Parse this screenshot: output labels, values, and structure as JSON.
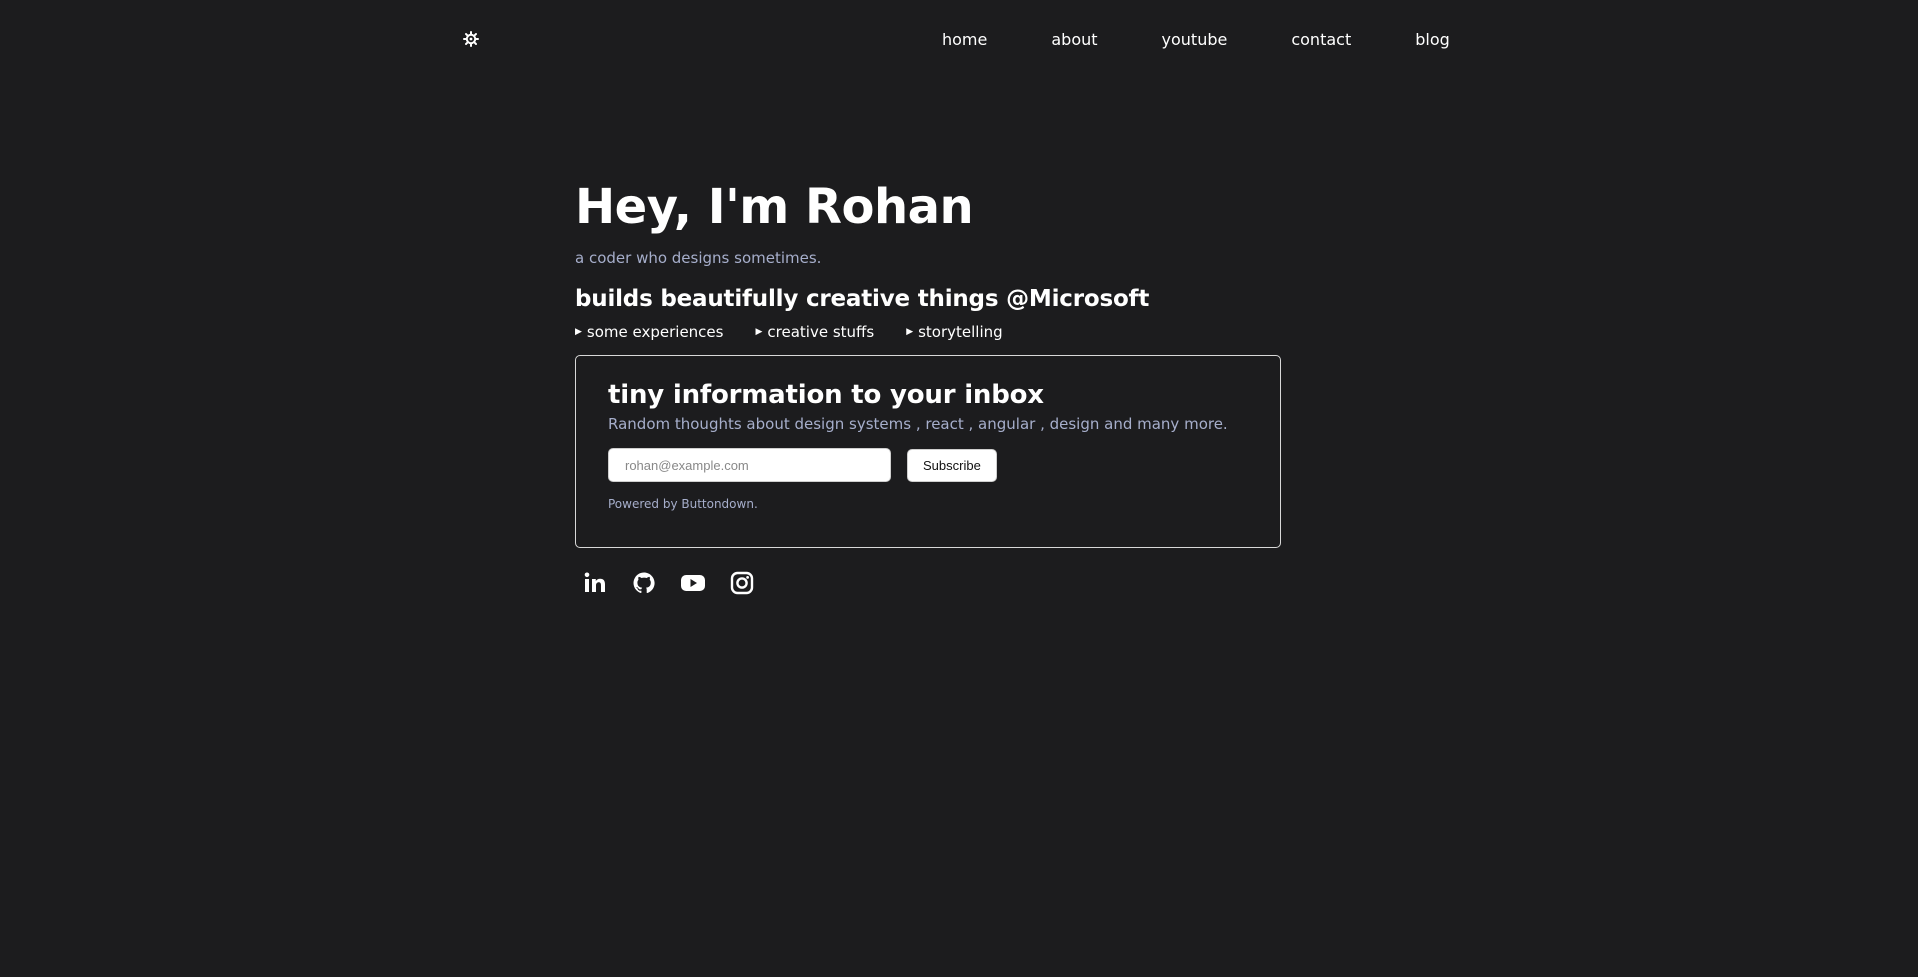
{
  "header": {
    "theme_icon": "sun-gear-icon",
    "nav": [
      {
        "label": "home"
      },
      {
        "label": "about"
      },
      {
        "label": "youtube"
      },
      {
        "label": "contact"
      },
      {
        "label": "blog"
      }
    ]
  },
  "hero": {
    "title": "Hey, I'm Rohan",
    "tagline": "a coder who designs sometimes.",
    "subtitle": "builds beautifully creative things @Microsoft",
    "links": [
      {
        "label": "some experiences"
      },
      {
        "label": "creative stuffs"
      },
      {
        "label": "storytelling"
      }
    ]
  },
  "newsletter": {
    "title": "tiny information to your inbox",
    "description": "Random thoughts about design systems , react , angular , design and many more.",
    "email_placeholder": "rohan@example.com",
    "email_value": "",
    "subscribe_label": "Subscribe",
    "powered_by": "Powered by Buttondown."
  },
  "socials": [
    {
      "icon": "linkedin-icon"
    },
    {
      "icon": "github-icon"
    },
    {
      "icon": "youtube-icon"
    },
    {
      "icon": "instagram-icon"
    }
  ],
  "colors": {
    "background": "#1c1c1e",
    "text": "#ffffff",
    "muted": "#a6aecb",
    "border": "#d8d8d8"
  }
}
